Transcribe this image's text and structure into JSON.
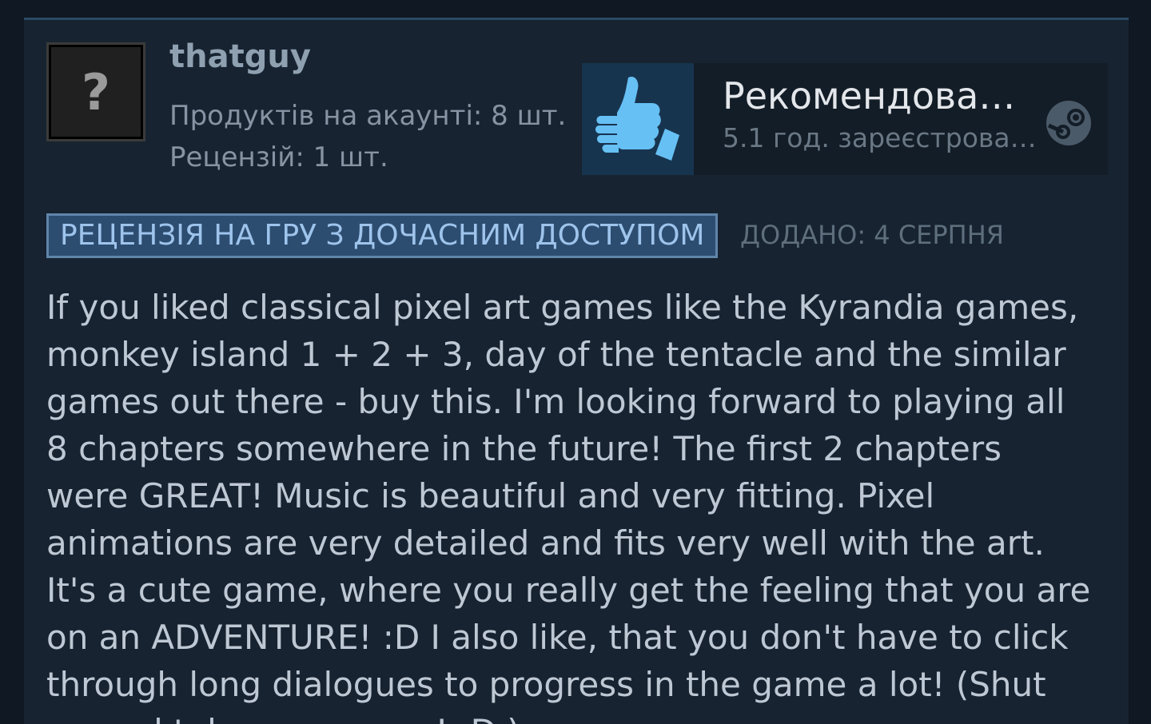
{
  "reviewer": {
    "name": "thatguy",
    "avatar_placeholder": "?",
    "products_text": "Продуктів на акаунті: 8 шт.",
    "reviews_text": "Рецензій: 1 шт."
  },
  "verdict": {
    "title": "Рекомендова…",
    "hours": "5.1 год. зареєстрова…",
    "thumb_icon": "thumbs-up-icon",
    "platform_icon": "steam-icon"
  },
  "review": {
    "badge": "РЕЦЕНЗІЯ НА ГРУ З ДОЧАСНИМ ДОСТУПОМ",
    "posted": "ДОДАНО: 4 СЕРПНЯ",
    "body": "If you liked classical pixel art games like the Kyrandia games, monkey island 1 + 2 + 3, day of the tentacle and the similar games out there - buy this. I'm looking forward to playing all 8 chapters somewhere in the future! The first 2 chapters were GREAT! Music is beautiful and very fitting. Pixel animations are very detailed and fits very well with the art. It's a cute game, where you really get the feeling that you are on an ADVENTURE! :D I also like, that you don't have to click through long dialogues to progress in the game a lot! (Shut up and take my money! :D )"
  },
  "colors": {
    "background": "#0f1823",
    "card": "#172330",
    "thumb_blue": "#66c0f4",
    "badge_bg": "#2d4d70",
    "badge_text": "#9ec4ec"
  }
}
